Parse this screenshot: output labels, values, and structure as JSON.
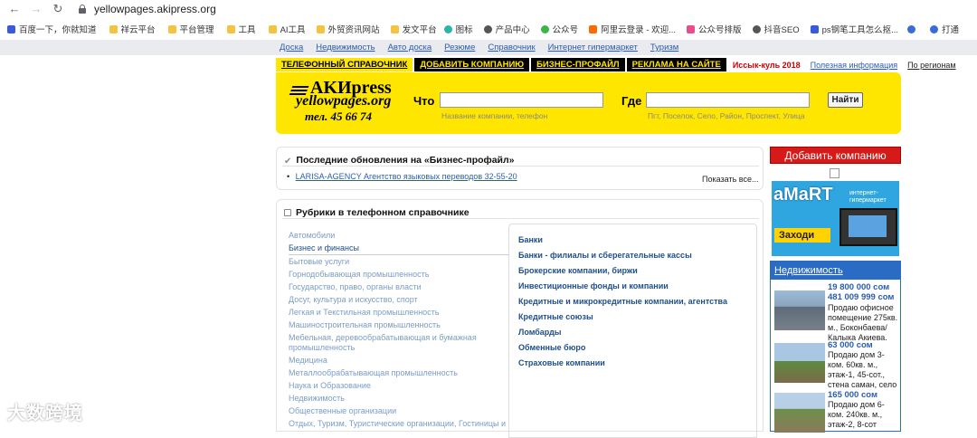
{
  "browser": {
    "url": "yellowpages.akipress.org",
    "bookmarks": [
      "百度一下，你就知道",
      "祥云平台",
      "平台管理",
      "工具",
      "AI工具",
      "外贸资讯网站",
      "发文平台",
      "图标",
      "产品中心",
      "公众号",
      "阿里云登录 - 欢迎...",
      "公众号排版",
      "抖音SEO",
      "ps钢笔工具怎么抠...",
      "打通"
    ]
  },
  "topmenu": [
    "Доска",
    "Недвижимость",
    "Авто доска",
    "Резюме",
    "Справочник",
    "Интернет гипермаркет",
    "Туризм"
  ],
  "tabs": [
    "ТЕЛЕФОННЫЙ СПРАВОЧНИК",
    "ДОБАВИТЬ КОМПАНИЮ",
    "БИЗНЕС-ПРОФАЙЛ",
    "РЕКЛАМА НА САЙТЕ"
  ],
  "tablinks": {
    "issyk": "Иссык-куль 2018",
    "info": "Полезная информация",
    "regions": "По регионам"
  },
  "logo": {
    "brand": "AKИpress",
    "sub": "yellowpages.org",
    "tel": "тел. 45 66 74"
  },
  "search": {
    "what_label": "Что",
    "what_hint": "Название компании, телефон",
    "where_label": "Где",
    "where_hint": "Пгт, Поселок, Село, Район, Проспект, Улица",
    "button": "Найти"
  },
  "updates": {
    "title": "Последние обновления на «Бизнес-профайл»",
    "item": "LARISA-AGENCY Агентство языковых переводов 32-55-20",
    "show_all": "Показать все..."
  },
  "rubrics": {
    "title": "Рубрики в телефонном справочнике",
    "categories": [
      "Автомобили",
      "Бизнес и финансы",
      "Бытовые услуги",
      "Горнодобывающая промышленность",
      "Государство, право, органы власти",
      "Досуг, культура и искусство, спорт",
      "Легкая и Текстильная промышленность",
      "Машиностроительная промышленность",
      "Мебельная, деревообрабатывающая и бумажная промышленность",
      "Медицина",
      "Металлообрабатывающая промышленность",
      "Наука и Образование",
      "Недвижимость",
      "Общественные организации",
      "Отдых, Туризм, Туристические организации, Гостиницы и"
    ],
    "selected": "Бизнес и финансы",
    "subcategories": [
      "Банки",
      "Банки - филиалы и сберегательные кассы",
      "Брокерские компании, биржи",
      "Инвестиционные фонды и компании",
      "Кредитные и микрокредитные компании, агентства",
      "Кредитные союзы",
      "Ломбарды",
      "Обменные бюро",
      "Страховые компании"
    ]
  },
  "sidebar": {
    "add_company": "Добавить компанию",
    "amart": {
      "logo": "aMaRT",
      "tag1": "интернет-",
      "tag2": "гипермаркет",
      "go": "Заходи"
    },
    "realty_title": "Недвижимость",
    "listings": [
      {
        "price1": "19 800 000 сом",
        "price2": "481 009 999 сом",
        "desc": "Продаю офисное помещение 275кв. м., Боконбаева/ Калыка Акиева."
      },
      {
        "price1": "63 000 сом",
        "desc": "Продаю дом 3-ком. 60кв. м., этаж-1, 45-сот., стена саман, село"
      },
      {
        "price1": "165 000 сом",
        "desc": "Продаю дом 6-ком. 240кв. м., этаж-2, 8-сот"
      }
    ]
  },
  "watermark": "大数跨境",
  "colors": {
    "yellow": "#ffe600",
    "link": "#2a5db0",
    "red": "#d61a1a",
    "realty_blue": "#2a6bc4"
  }
}
